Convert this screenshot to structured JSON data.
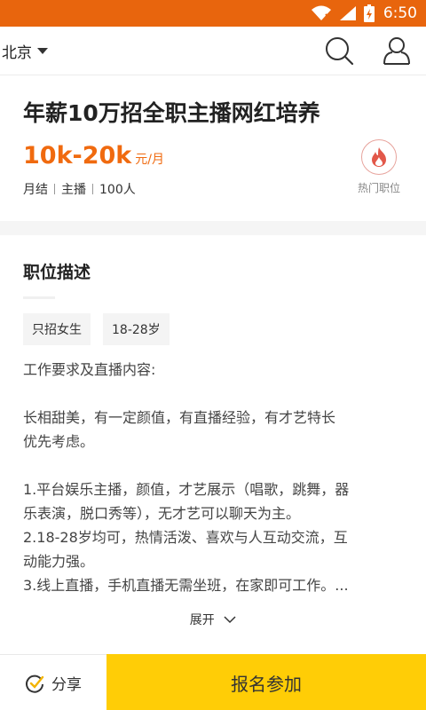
{
  "status_bar": {
    "time": "6:50",
    "bg_color": "#e8650d"
  },
  "nav": {
    "city": "北京",
    "icons": [
      "chevron-down-icon",
      "search-icon",
      "user-icon"
    ]
  },
  "job": {
    "title": "年薪10万招全职主播网红培养",
    "salary_range": "10k-20k",
    "salary_unit": "元/月",
    "meta": [
      "月结",
      "主播",
      "100人"
    ],
    "hot_label": "热门职位",
    "accent_color": "#f06a0f"
  },
  "description": {
    "heading": "职位描述",
    "tags": [
      "只招女生",
      "18-28岁"
    ],
    "lines": [
      "工作要求及直播内容:",
      "",
      "长相甜美，有一定颜值，有直播经验，有才艺特长",
      "优先考虑。",
      "",
      "1.平台娱乐主播，颜值，才艺展示（唱歌，跳舞，器",
      "乐表演，脱口秀等），无才艺可以聊天为主。",
      "2.18-28岁均可，热情活泼、喜欢与人互动交流，互",
      "动能力强。",
      "3.线上直播，手机直播无需坐班，在家即可工作。..."
    ],
    "expand_label": "展开"
  },
  "bottom": {
    "share_label": "分享",
    "apply_label": "报名参加",
    "apply_color": "#ffcd06"
  }
}
